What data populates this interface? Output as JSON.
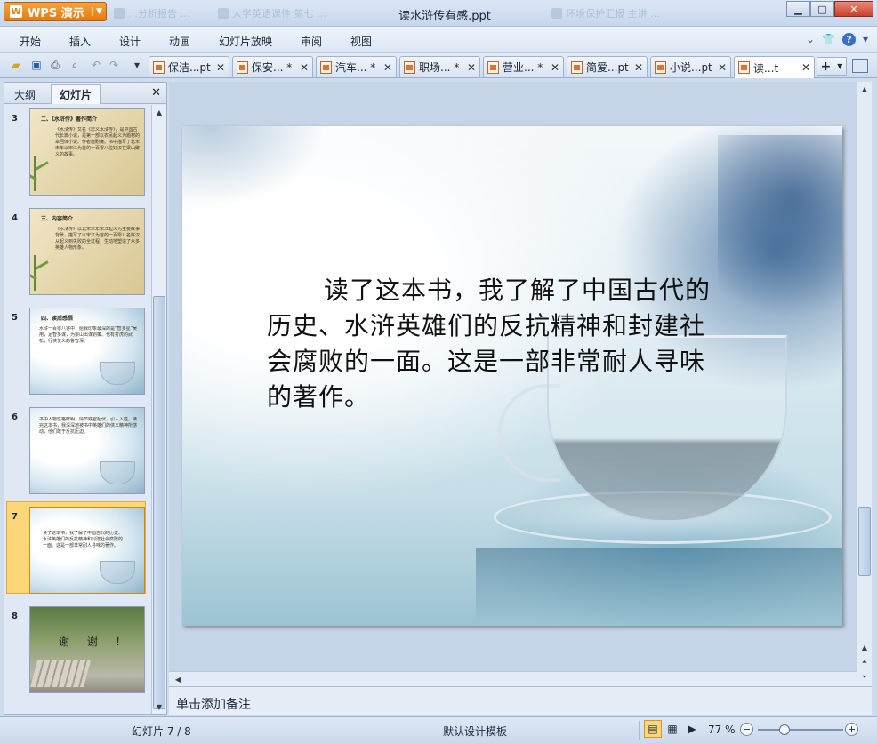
{
  "app": {
    "name": "WPS 演示",
    "logo_letter": "W"
  },
  "window": {
    "title": "读水浒传有感.ppt",
    "background_tabs": [
      "…分析报告 …",
      "大学英语课件 第七 …",
      "…",
      "环境保护汇报 主讲 …"
    ]
  },
  "menu": {
    "items": [
      "开始",
      "插入",
      "设计",
      "动画",
      "幻灯片放映",
      "审阅",
      "视图"
    ]
  },
  "doc_tabs": [
    {
      "label": "保洁...pt",
      "active": false
    },
    {
      "label": "保安... *",
      "active": false
    },
    {
      "label": "汽车... *",
      "active": false
    },
    {
      "label": "职场... *",
      "active": false
    },
    {
      "label": "营业... *",
      "active": false
    },
    {
      "label": "简爱...pt",
      "active": false
    },
    {
      "label": "小说...pt",
      "active": false
    },
    {
      "label": "读...t",
      "active": true
    }
  ],
  "left_panel": {
    "tab_outline": "大纲",
    "tab_slides": "幻灯片",
    "thumbnails": [
      {
        "number": "3",
        "title": "二、《水浒传》著作简介",
        "body": "《水浒传》又名《忠义水浒传》，是中国古代长篇小说，是第一部以农民起义为题材的章回体小说。作者施耐庵。书中描写了北宋末年以宋江为首的一百零八位好汉在梁山聚义的故事。",
        "selected": false
      },
      {
        "number": "4",
        "title": "三、内容简介",
        "body": "《水浒传》以北宋末年宋江起义为主要故事背景，描写了以宋江为首的一百零八名好汉从起义到失败的全过程，生动地塑造了众多英雄人物形象。",
        "selected": false
      },
      {
        "number": "5",
        "title": "四、读后感悟",
        "body": "水浒一百零八将中，给我印象最深的是“智多星”吴用，足智多谋，为梁山出谋划策。也有打虎的武松，行侠仗义的鲁智深。",
        "selected": false
      },
      {
        "number": "6",
        "title": "",
        "body": "书中人物性格鲜明，情节跌宕起伏，引人入胜。读完这本书，我深深地被书中英雄们的侠义精神所感动，他们敢于反抗压迫。",
        "selected": false
      },
      {
        "number": "7",
        "title": "",
        "body": "读了这本书，我了解了中国古代的历史、水浒英雄们的反抗精神和封建社会腐败的一面。这是一部非常耐人寻味的著作。",
        "selected": true
      },
      {
        "number": "8",
        "title": "",
        "body": "谢 谢 ！",
        "selected": false
      }
    ]
  },
  "slide": {
    "text": "读了这本书，我了解了中国古代的历史、水浒英雄们的反抗精神和封建社会腐败的一面。这是一部非常耐人寻味的著作。"
  },
  "notes": {
    "placeholder": "单击添加备注"
  },
  "status": {
    "slide_counter": "幻灯片 7 / 8",
    "template": "默认设计模板",
    "zoom": "77 %",
    "zoom_fraction": 0.31
  },
  "colors": {
    "app_button": "#e57b0d",
    "selection": "#fbd77a",
    "chrome": "#cfdcec"
  }
}
